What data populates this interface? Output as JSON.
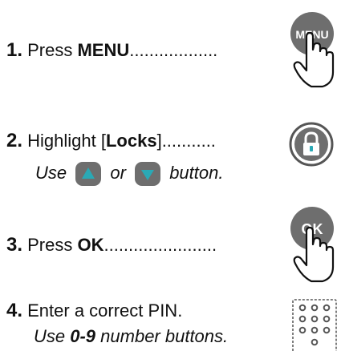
{
  "steps": [
    {
      "num": "1.",
      "pre": " Press ",
      "bold": "MENU",
      "post": "",
      "dots": "..................",
      "icon": "menu-hand-icon",
      "icon_text": "MENU"
    },
    {
      "num": "2.",
      "pre": " Highlight [",
      "bold": "Locks",
      "post": "]",
      "dots": "...........",
      "icon": "lock-icon"
    },
    {
      "num": "3.",
      "pre": " Press ",
      "bold": "OK",
      "post": "",
      "dots": ".......................",
      "icon": "ok-hand-icon",
      "icon_text": "OK"
    },
    {
      "num": "4.",
      "pre": " Enter a correct PIN.",
      "bold": "",
      "post": "",
      "dots": "",
      "icon": "keypad-icon"
    }
  ],
  "step2_sub": {
    "use": "Use",
    "or": "or",
    "button": "button."
  },
  "step4_sub": {
    "use": "Use ",
    "bold": "0-9",
    "rest": " number buttons."
  },
  "colors": {
    "button_gray": "#6e6e6e",
    "arrow_teal": "#2aa9b5",
    "keypad_dot": "#555555"
  }
}
